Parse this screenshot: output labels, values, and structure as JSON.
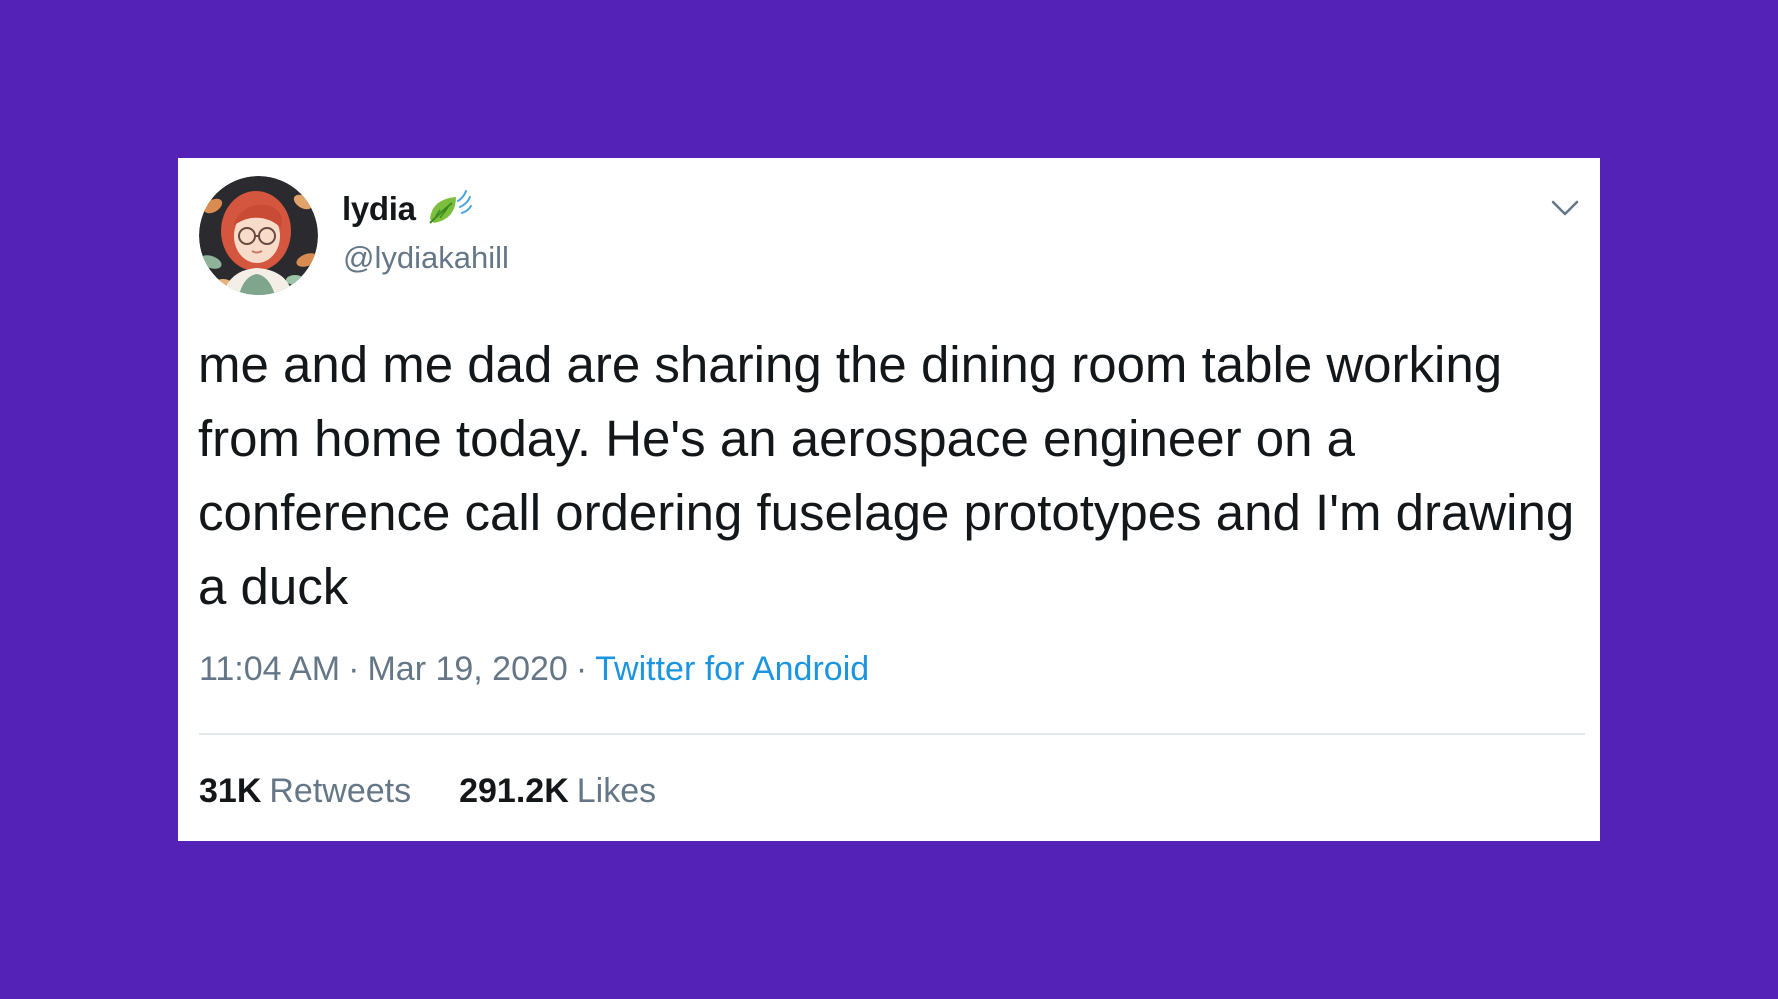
{
  "tweet": {
    "display_name": "lydia",
    "handle": "@lydiakahill",
    "text": "me and me dad are sharing the dining room table working from home today. He's an aerospace engineer on a conference call ordering fuselage prototypes and I'm drawing a duck",
    "time": "11:04 AM",
    "date": "Mar 19, 2020",
    "separator": "·",
    "source": "Twitter for Android",
    "retweets_count": "31K",
    "retweets_label": "Retweets",
    "likes_count": "291.2K",
    "likes_label": "Likes"
  },
  "icons": {
    "name_badge": "leaf-fluttering-in-wind-icon",
    "menu": "chevron-down-icon",
    "avatar": "illustrated-avatar"
  },
  "colors": {
    "background": "#5522b8",
    "card": "#ffffff",
    "text_primary": "#14171a",
    "text_secondary": "#657786",
    "link": "#1b95e0",
    "divider": "#e1e8ed"
  }
}
